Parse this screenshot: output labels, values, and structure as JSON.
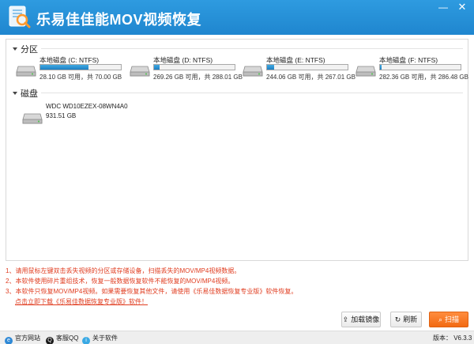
{
  "app": {
    "title": "乐易佳佳能MOV视频恢复",
    "window_controls": [
      "minimize-icon",
      "close-icon"
    ]
  },
  "partitions": {
    "label": "分区",
    "drives": [
      {
        "name": "本地磁盘 (C: NTFS)",
        "size": "28.10 GB 可用，共 70.00 GB",
        "used_fraction": 0.6
      },
      {
        "name": "本地磁盘 (D: NTFS)",
        "size": "269.26 GB 可用，共 288.01 GB",
        "used_fraction": 0.07
      },
      {
        "name": "本地磁盘 (E: NTFS)",
        "size": "244.06 GB 可用，共 267.01 GB",
        "used_fraction": 0.09
      },
      {
        "name": "本地磁盘 (F: NTFS)",
        "size": "282.36 GB 可用，共 286.48 GB",
        "used_fraction": 0.02
      }
    ]
  },
  "disks": {
    "label": "磁盘",
    "items": [
      {
        "name": "WDC WD10EZEX-08WN4A0",
        "size": "931.51 GB"
      }
    ]
  },
  "notes": [
    "1、请用鼠标左键双击丢失视频的分区或存储设备，扫描丢失的MOV/MP4视频数据。",
    "2、本软件使用碎片重组技术，恢复一般数据恢复软件不能恢复的MOV/MP4视频。",
    "3、本软件只恢复MOV/MP4视频。如果需要恢复其他文件，请使用《乐易佳数据恢复专业版》软件恢复。"
  ],
  "download_link": "点击立即下载《乐易佳数据恢复专业版》软件！",
  "buttons": {
    "mount": "加载镜像",
    "refresh": "刷新",
    "scan": "扫描"
  },
  "statusbar": {
    "website": "官方网站",
    "qq": "客服QQ",
    "about": "关于软件",
    "version": "版本： V6.3.3"
  },
  "colors": {
    "title_bar": "#1f86cf",
    "scan_button": "#f26a12",
    "notes_text": "#e03c1f",
    "usage_fill": "#1f7fc2"
  }
}
